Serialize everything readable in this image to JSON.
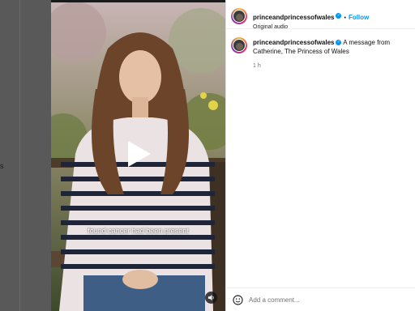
{
  "background": {
    "side_text": "s"
  },
  "video": {
    "caption": "found cancer had been present",
    "play_icon": "play-icon",
    "audio_icon": "speaker-icon"
  },
  "post": {
    "username": "princeandprincessofwales",
    "follow_label": "Follow",
    "separator": "•",
    "audio": "Original audio",
    "caption_text": "A message from Catherine, The Princess of Wales",
    "time": "1 h",
    "verified_color": "#0095f6"
  },
  "comment": {
    "placeholder": "Add a comment..."
  },
  "colors": {
    "accent": "#0095f6",
    "panel_bg": "#ffffff",
    "dim": "#555555"
  }
}
